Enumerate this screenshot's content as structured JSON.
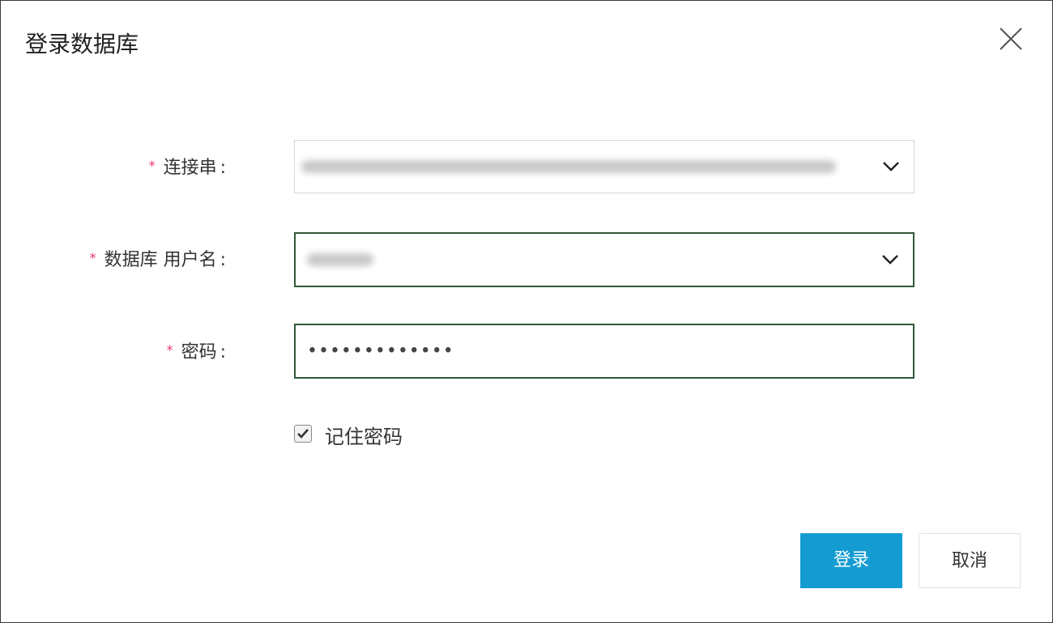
{
  "dialog": {
    "title": "登录数据库",
    "close_icon": "close-icon"
  },
  "form": {
    "required_mark": "*",
    "connection": {
      "label": "连接串",
      "colon": ":",
      "value_hidden": true,
      "icon": "chevron-down-icon"
    },
    "username": {
      "label": "数据库 用户名",
      "colon": ":",
      "value_hidden": true,
      "icon": "chevron-down-icon"
    },
    "password": {
      "label": "密码",
      "colon": ":",
      "masked_value": "•••••••••••••"
    },
    "remember": {
      "label": "记住密码",
      "checked": true
    }
  },
  "buttons": {
    "login": "登录",
    "cancel": "取消"
  },
  "colors": {
    "accent": "#149cd2",
    "active_border": "#2f5a3a",
    "required": "#e8327a"
  }
}
